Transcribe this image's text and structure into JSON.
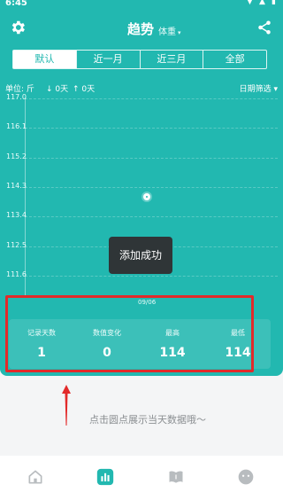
{
  "status_bar": {
    "time": "6:45",
    "icons": "▼ ▲ ▮"
  },
  "header": {
    "title": "趋势",
    "metric_selector": "体重",
    "metric_caret": "▾"
  },
  "tabs": [
    {
      "label": "默认",
      "active": true
    },
    {
      "label": "近一月",
      "active": false
    },
    {
      "label": "近三月",
      "active": false
    },
    {
      "label": "全部",
      "active": false
    }
  ],
  "unit_row": {
    "unit_label": "单位: 斤",
    "down_days": "↓ 0天",
    "up_days": "↑ 0天",
    "date_filter": "日期筛选 ▾"
  },
  "chart_data": {
    "type": "line",
    "title": "",
    "xlabel": "",
    "ylabel": "",
    "y_ticks": [
      "117.0",
      "116.1",
      "115.2",
      "114.3",
      "113.4",
      "112.5",
      "111.6"
    ],
    "ylim": [
      111.6,
      117.0
    ],
    "x": [
      "09/06"
    ],
    "values": [
      114
    ]
  },
  "toast": {
    "text": "添加成功"
  },
  "stats": [
    {
      "label": "记录天数",
      "value": "1"
    },
    {
      "label": "数值变化",
      "value": "0"
    },
    {
      "label": "最高",
      "value": "114"
    },
    {
      "label": "最低",
      "value": "114"
    }
  ],
  "hint": {
    "text": "点击圆点展示当天数据哦～"
  },
  "colors": {
    "teal": "#22b8b0",
    "annotation_red": "#e22a2a",
    "toast_bg": "#2f3537"
  },
  "bottom_nav": [
    {
      "icon": "home-icon"
    },
    {
      "icon": "trend-icon"
    },
    {
      "icon": "book-icon"
    },
    {
      "icon": "face-icon"
    }
  ]
}
